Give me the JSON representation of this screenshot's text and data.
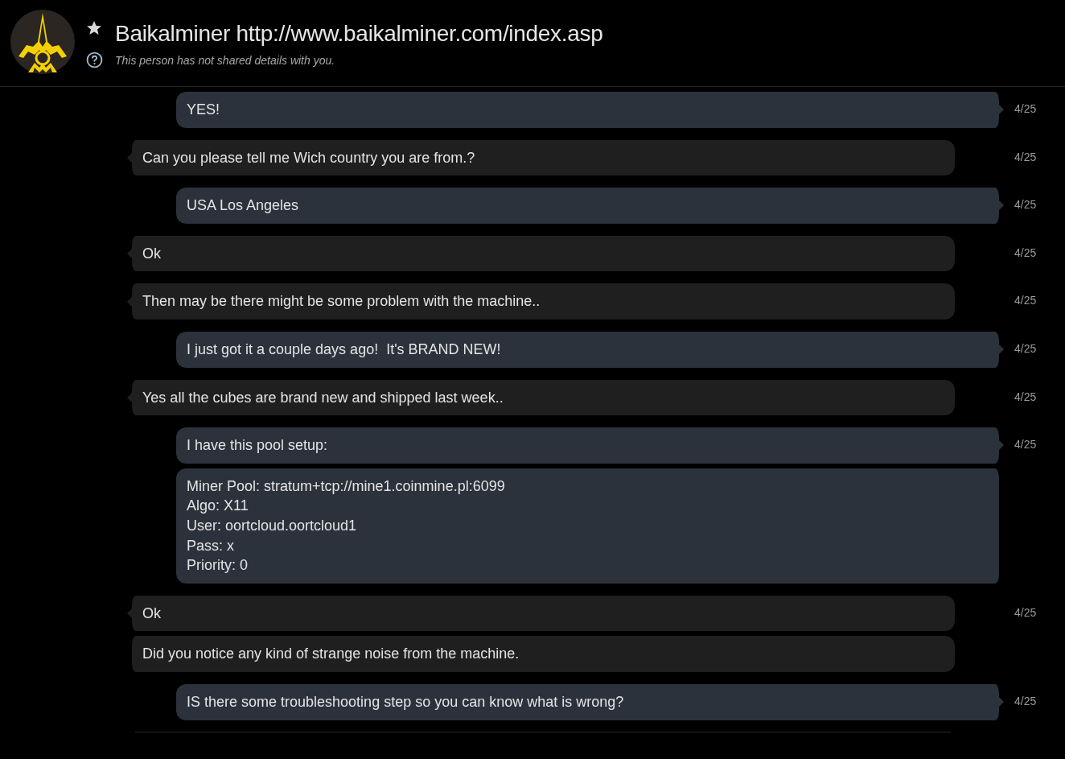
{
  "header": {
    "title": "Baikalminer http://www.baikalminer.com/index.asp",
    "favorite": true,
    "subtitle": "This person has not shared details with you."
  },
  "messages": [
    {
      "outgoing": true,
      "tail": true,
      "text": "YES!",
      "time": "4/25"
    },
    {
      "outgoing": false,
      "tail": true,
      "text": "Can you please tell me Wich country you are from.?",
      "time": "4/25"
    },
    {
      "outgoing": true,
      "tail": true,
      "text": "USA Los Angeles",
      "time": "4/25"
    },
    {
      "outgoing": false,
      "tail": true,
      "text": "Ok",
      "time": "4/25"
    },
    {
      "outgoing": false,
      "tail": true,
      "text": "Then may be there might be some problem with the machine..",
      "time": "4/25"
    },
    {
      "outgoing": true,
      "tail": true,
      "text": "I just got it a couple days ago!  It's BRAND NEW!",
      "time": "4/25"
    },
    {
      "outgoing": false,
      "tail": true,
      "text": "Yes all the cubes are brand new and shipped last week..",
      "time": "4/25"
    },
    {
      "outgoing": true,
      "tail": true,
      "text": "I have this pool setup:",
      "time": "4/25"
    },
    {
      "outgoing": true,
      "tail": false,
      "text": "Miner Pool: stratum+tcp://mine1.coinmine.pl:6099\nAlgo: X11\nUser: oortcloud.oortcloud1\nPass: x\nPriority: 0"
    },
    {
      "outgoing": false,
      "tail": true,
      "text": "Ok",
      "time": "4/25"
    },
    {
      "outgoing": false,
      "tail": false,
      "text": "Did you notice any kind of strange noise from the machine."
    },
    {
      "outgoing": true,
      "tail": true,
      "text": "IS there some troubleshooting step so you can know what is wrong?",
      "time": "4/25"
    }
  ]
}
